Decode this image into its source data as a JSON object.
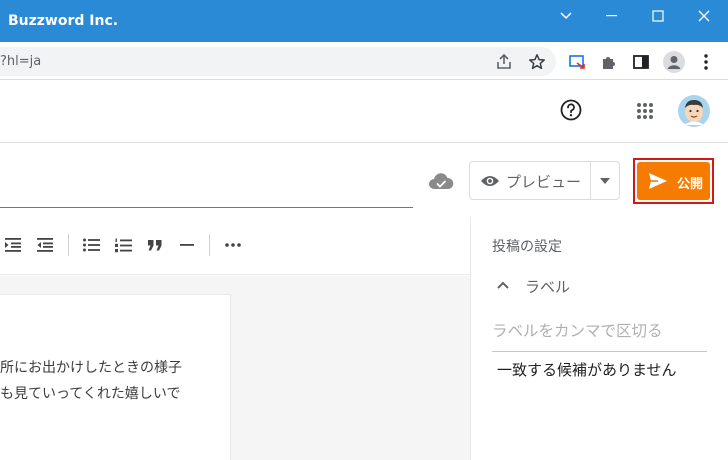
{
  "window": {
    "title": "Buzzword Inc."
  },
  "browser": {
    "url_fragment": "?hl=ja"
  },
  "editor": {
    "preview_label": "プレビュー",
    "publish_label": "公開",
    "body_lines": [
      "所にお出かけしたときの様子",
      "も見ていってくれた嬉しいで"
    ]
  },
  "settings_panel": {
    "title": "投稿の設定",
    "labels_header": "ラベル",
    "labels_placeholder": "ラベルをカンマで区切る",
    "no_match": "一致する候補がありません"
  },
  "colors": {
    "titlebar": "#2b8ad6",
    "publish": "#f57c00",
    "publish_outline": "#d01818",
    "title_underline": "#e8453c"
  }
}
